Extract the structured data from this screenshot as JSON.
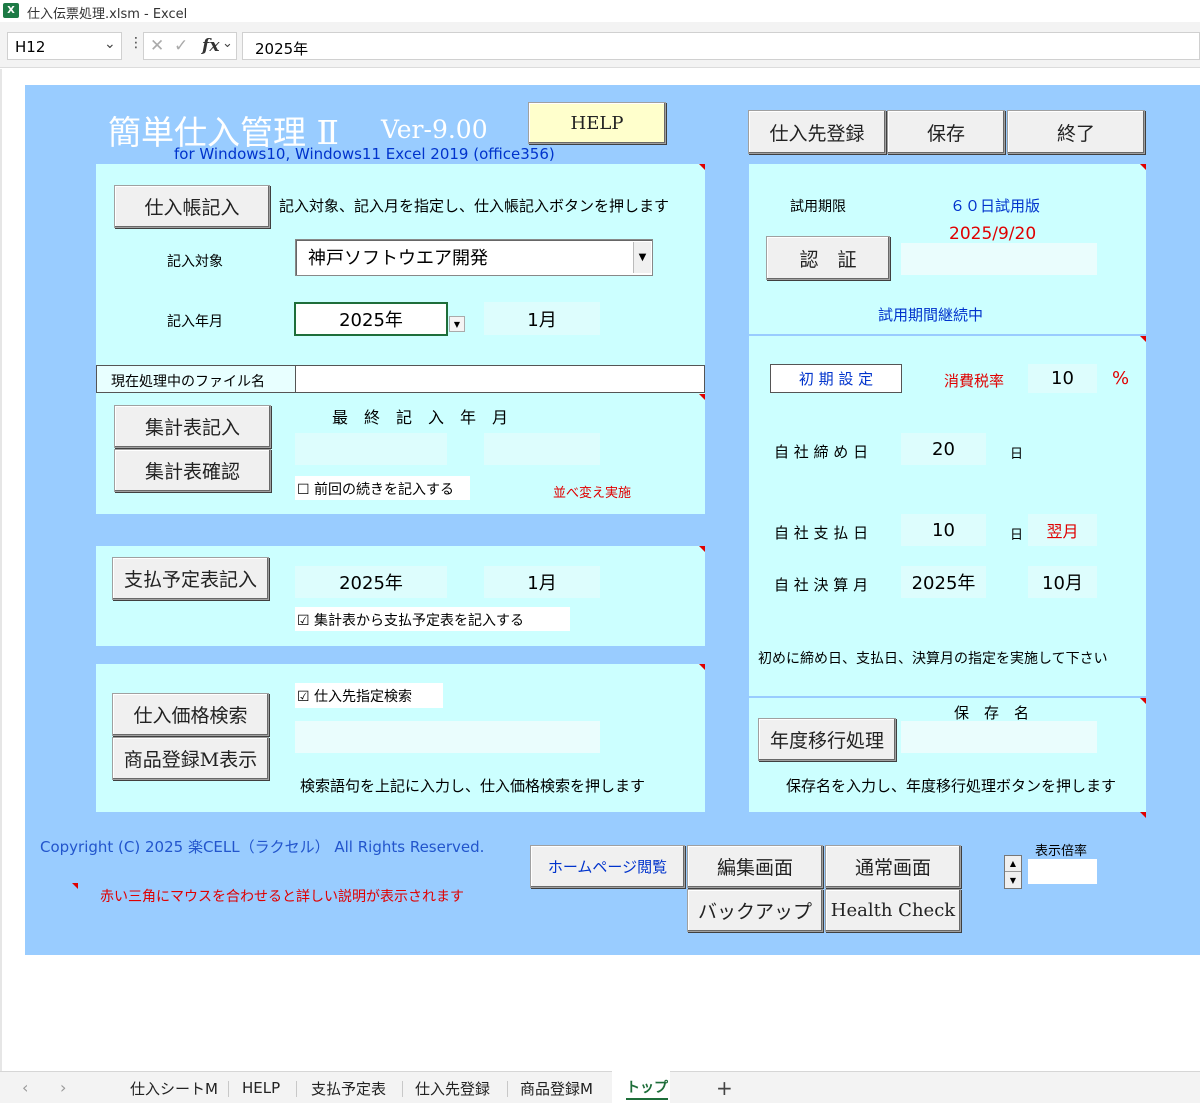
{
  "window": {
    "title": "仕入伝票処理.xlsm - Excel",
    "app_icon": "excel-icon"
  },
  "formula_bar": {
    "name_box": "H12",
    "value": "2025年",
    "fx_label": "fx"
  },
  "header": {
    "title": "簡単仕入管理 Ⅱ",
    "version": "Ver-9.00",
    "subtitle": "for Windows10, Windows11  Excel 2019 (office356)",
    "help_label": "HELP"
  },
  "top_buttons": {
    "supplier_register": "仕入先登録",
    "save": "保存",
    "exit": "終了"
  },
  "ledger": {
    "button": "仕入帳記入",
    "instruction": "記入対象、記入月を指定し、仕入帳記入ボタンを押します",
    "target_label": "記入対象",
    "target_value": "神戸ソフトウエア開発",
    "ym_label": "記入年月",
    "year": "2025年",
    "month": "1月"
  },
  "current_file": {
    "label": "現在処理中のファイル名",
    "value": ""
  },
  "summary": {
    "record_button": "集計表記入",
    "confirm_button": "集計表確認",
    "last_label": "最　終　記　入　年　月",
    "last_year": "",
    "last_month": "",
    "continue_checkbox": "☐ 前回の続きを記入する",
    "sort_note": "並べ変え実施"
  },
  "payment": {
    "button": "支払予定表記入",
    "year": "2025年",
    "month": "1月",
    "checkbox": "☑ 集計表から支払予定表を記入する"
  },
  "price": {
    "search_button": "仕入価格検索",
    "product_button": "商品登録M表示",
    "checkbox": "☑ 仕入先指定検索",
    "search_value": "",
    "instruction": "検索語句を上記に入力し、仕入価格検索を押します"
  },
  "trial": {
    "label": "試用期限",
    "edition": "６０日試用版",
    "date": "2025/9/20",
    "auth_button": "認　証",
    "auth_value": "",
    "status": "試用期間継続中"
  },
  "settings": {
    "initial_label": "初 期 設 定",
    "tax_label": "消費税率",
    "tax_value": "10",
    "tax_unit": "%",
    "closing_label": "自 社 締 め 日",
    "closing_value": "20",
    "day_unit": "日",
    "payday_label": "自 社 支 払 日",
    "payday_value": "10",
    "payday_unit": "日",
    "payday_month": "翌月",
    "fiscal_label": "自 社 決 算 月",
    "fiscal_year": "2025年",
    "fiscal_month": "10月",
    "note": "初めに締め日、支払日、決算月の指定を実施して下さい"
  },
  "year_transfer": {
    "save_name_label": "保　存　名",
    "button": "年度移行処理",
    "value": "",
    "instruction": "保存名を入力し、年度移行処理ボタンを押します"
  },
  "footer": {
    "copyright": "Copyright (C) 2025 楽CELL（ラクセル）  All Rights Reserved.",
    "hint": "赤い三角にマウスを合わせると詳しい説明が表示されます",
    "homepage": "ホームページ閲覧",
    "edit_screen": "編集画面",
    "normal_screen": "通常画面",
    "backup": "バックアップ",
    "health_check": "Health Check",
    "zoom_label": "表示倍率",
    "zoom_value": ""
  },
  "sheet_tabs": [
    "仕入シートM",
    "HELP",
    "支払予定表",
    "仕入先登録",
    "商品登録M",
    "トップ"
  ],
  "active_tab": "トップ",
  "colors": {
    "background": "#99ccff",
    "panel": "#ccffff",
    "cell": "#ddfdfd",
    "title": "#ffffff",
    "accent_blue": "#0033cc",
    "red": "#e00000"
  }
}
